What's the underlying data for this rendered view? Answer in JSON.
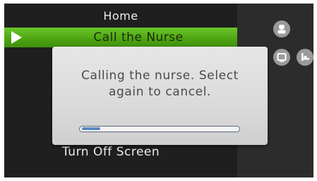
{
  "menu": {
    "home_label": "Home",
    "selected_item_label": "Call the Nurse",
    "turn_off_label": "Turn Off Screen"
  },
  "dialog": {
    "message_line1": "Calling the nurse. Select",
    "message_line2": "again to cancel.",
    "progress_percent": 12
  },
  "side_panel": {
    "icons": [
      "nurse-icon",
      "tv-icon",
      "bed-icon"
    ]
  },
  "colors": {
    "selected_green": "#4ea613",
    "progress_blue": "#5b8bc0"
  }
}
